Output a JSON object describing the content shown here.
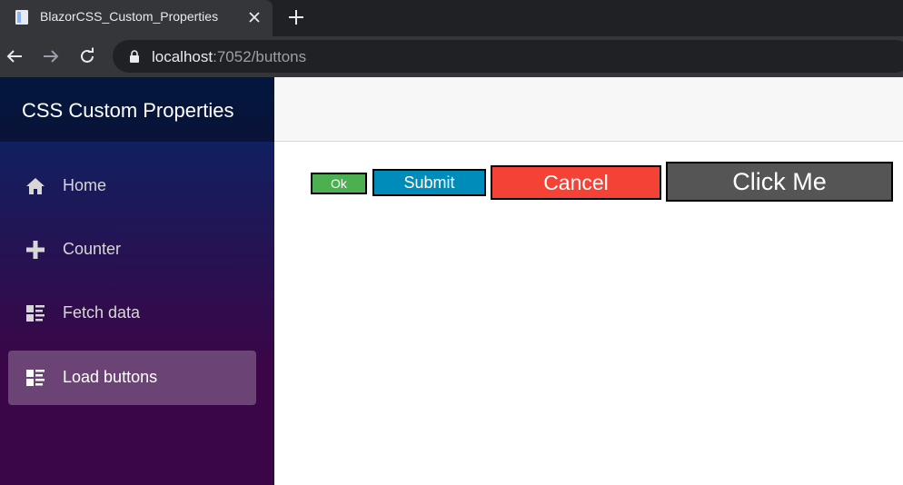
{
  "browser": {
    "tab": {
      "title": "BlazorCSS_Custom_Properties",
      "favicon": "page-icon"
    },
    "address": {
      "host": "localhost",
      "rest": ":7052/buttons"
    },
    "icons": [
      "back-icon",
      "forward-icon",
      "reload-icon",
      "lock-icon",
      "close-icon",
      "plus-icon"
    ]
  },
  "app": {
    "brand": "CSS Custom Properties",
    "nav": [
      {
        "label": "Home",
        "icon": "home-icon"
      },
      {
        "label": "Counter",
        "icon": "plus-icon"
      },
      {
        "label": "Fetch data",
        "icon": "list-icon"
      },
      {
        "label": "Load buttons",
        "icon": "list-icon",
        "active": true
      }
    ]
  },
  "buttons": [
    {
      "label": "Ok",
      "color": "#4caf50"
    },
    {
      "label": "Submit",
      "color": "#008cba"
    },
    {
      "label": "Cancel",
      "color": "#f44336"
    },
    {
      "label": "Click Me",
      "color": "#555555"
    }
  ]
}
